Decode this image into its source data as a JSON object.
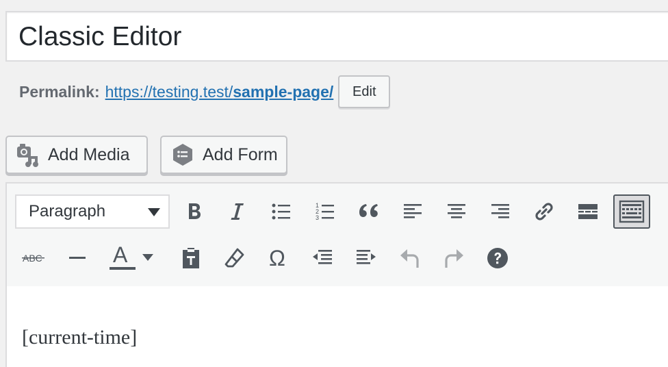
{
  "post": {
    "title": "Classic Editor"
  },
  "permalink": {
    "label": "Permalink:",
    "url_base": "https://testing.test/",
    "url_slug": "sample-page/",
    "edit_label": "Edit"
  },
  "media_buttons": {
    "add_media_label": "Add Media",
    "add_form_label": "Add Form"
  },
  "toolbar": {
    "format_select_value": "Paragraph",
    "row1": [
      "bold-icon",
      "italic-icon",
      "bulleted-list-icon",
      "numbered-list-icon",
      "blockquote-icon",
      "align-left-icon",
      "align-center-icon",
      "align-right-icon",
      "link-icon",
      "read-more-icon",
      "toolbar-toggle-icon"
    ],
    "row2": [
      "strikethrough-icon",
      "horizontal-line-icon",
      "text-color-icon",
      "paste-as-text-icon",
      "clear-formatting-icon",
      "special-character-icon",
      "outdent-icon",
      "indent-icon",
      "undo-icon",
      "redo-icon",
      "help-icon"
    ],
    "strikethrough_glyph": "ABC",
    "text_color_glyph": "A",
    "special_char_glyph": "Ω",
    "numbered_list_digits": [
      "1",
      "2",
      "3"
    ],
    "active_button": "toolbar-toggle-icon"
  },
  "content": {
    "body": "[current-time]"
  },
  "colors": {
    "link": "#2271b1",
    "icon": "#50575e",
    "disabled_icon": "#a7aaad",
    "background": "#f1f1f1"
  }
}
